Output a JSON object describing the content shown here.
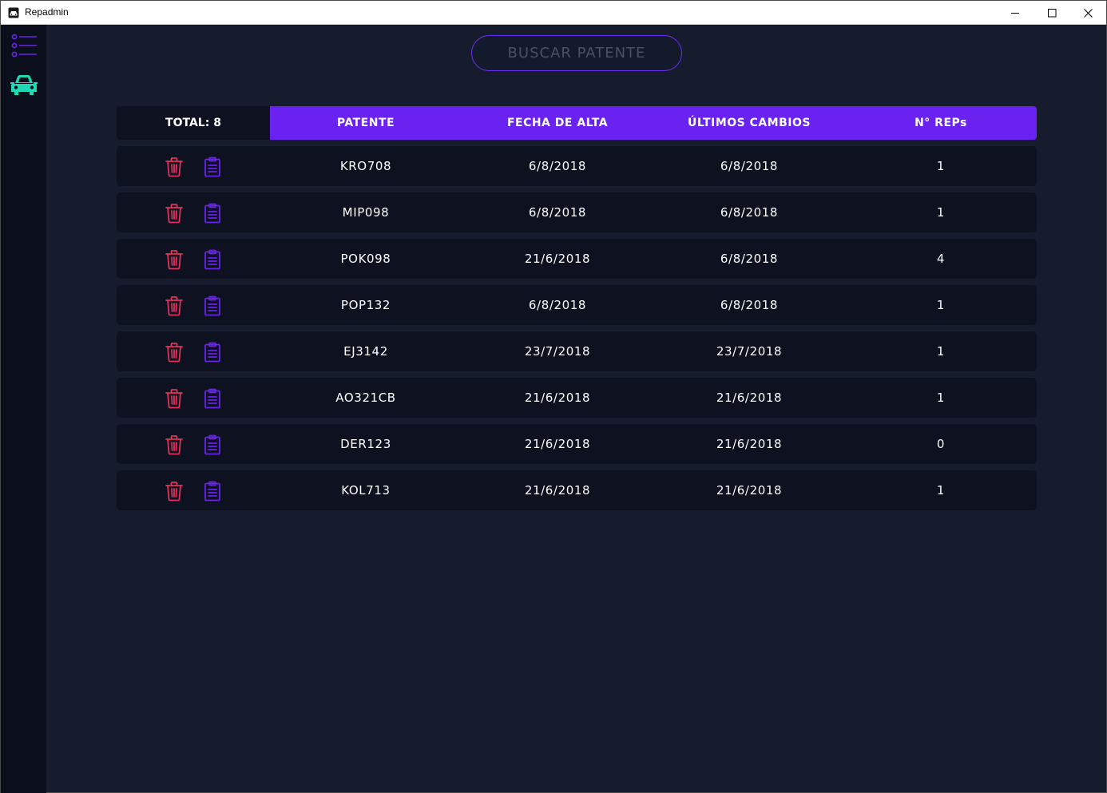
{
  "window": {
    "title": "Repadmin"
  },
  "colors": {
    "accent": "#6a22f0",
    "background": "#161c2e",
    "row_bg": "#0d1120",
    "delete_icon": "#e0325a",
    "doc_icon": "#6a22f0",
    "car_icon": "#1ed9b5"
  },
  "sidebar": {
    "items": [
      {
        "icon": "menu-list-icon"
      },
      {
        "icon": "car-icon"
      }
    ]
  },
  "search": {
    "label": "BUSCAR PATENTE"
  },
  "table": {
    "total_label": "TOTAL: 8",
    "columns": [
      "PATENTE",
      "FECHA DE ALTA",
      "ÚLTIMOS CAMBIOS",
      "N° REPs"
    ],
    "rows": [
      {
        "patente": "KRO708",
        "fecha_alta": "6/8/2018",
        "ultimos_cambios": "6/8/2018",
        "reps": "1"
      },
      {
        "patente": "MIP098",
        "fecha_alta": "6/8/2018",
        "ultimos_cambios": "6/8/2018",
        "reps": "1"
      },
      {
        "patente": "POK098",
        "fecha_alta": "21/6/2018",
        "ultimos_cambios": "6/8/2018",
        "reps": "4"
      },
      {
        "patente": "POP132",
        "fecha_alta": "6/8/2018",
        "ultimos_cambios": "6/8/2018",
        "reps": "1"
      },
      {
        "patente": "EJ3142",
        "fecha_alta": "23/7/2018",
        "ultimos_cambios": "23/7/2018",
        "reps": "1"
      },
      {
        "patente": "AO321CB",
        "fecha_alta": "21/6/2018",
        "ultimos_cambios": "21/6/2018",
        "reps": "1"
      },
      {
        "patente": "DER123",
        "fecha_alta": "21/6/2018",
        "ultimos_cambios": "21/6/2018",
        "reps": "0"
      },
      {
        "patente": "KOL713",
        "fecha_alta": "21/6/2018",
        "ultimos_cambios": "21/6/2018",
        "reps": "1"
      }
    ]
  }
}
